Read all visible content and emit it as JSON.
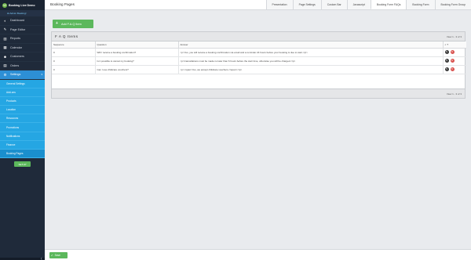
{
  "app": {
    "brand_name": "Booking Live Demo",
    "brand_logo": "W",
    "user_label": "Hi Admin Booking!"
  },
  "sidebar": {
    "items": [
      {
        "label": "Dashboard",
        "icon": "gauge-icon",
        "glyph": "◐"
      },
      {
        "label": "Page Editor",
        "icon": "pencil-icon",
        "glyph": "✎"
      },
      {
        "label": "Reports",
        "icon": "chart-icon",
        "glyph": "▥"
      },
      {
        "label": "Calendar",
        "icon": "calendar-icon",
        "glyph": "▦"
      },
      {
        "label": "Customers",
        "icon": "users-icon",
        "glyph": "☻"
      },
      {
        "label": "Orders",
        "icon": "cart-icon",
        "glyph": "▤"
      },
      {
        "label": "Settings",
        "icon": "gear-icon",
        "glyph": "⚙"
      }
    ],
    "settings_chevron": "▾",
    "submenu": [
      "General Settings",
      "Add-ons",
      "Products",
      "Location",
      "Resources",
      "Promotions",
      "Notifications",
      "Finance",
      "Booking Pages"
    ],
    "setup_button": "SETUP"
  },
  "header": {
    "title": "Booking Pages",
    "tabs": [
      "Presentation",
      "Page Settings",
      "Custom Bar",
      "Javascript",
      "Booking Form FAQs",
      "Booking Form",
      "Booking Form Group"
    ],
    "active_tab": "Booking Form FAQs"
  },
  "main": {
    "add_button": "Add F.A.Q Item",
    "grid": {
      "caption": "F A Q Items",
      "view_info": "View 1 - 3 of 3",
      "columns": [
        "Sequence",
        "Question",
        "Answer",
        ""
      ],
      "filter_glyph": "⌕ ▾",
      "rows": [
        {
          "sequence": "0",
          "question": "Will I receive a booking confirmation?",
          "answer": "<p>Yes, you will receive a booking confirmation via email and a reminder 24 hours before your booking is due to start.</p>"
        },
        {
          "sequence": "0",
          "question": "Is it possible to cancel my booking?",
          "answer": "<p>Cancellations must be made no later than 6 hours before the start time, otherwise you will be charged.</p>"
        },
        {
          "sequence": "0",
          "question": "Can I use childcare vouchers?",
          "answer": "<p><span>Yes, we accept childcare vouchers.</span></p>"
        }
      ],
      "footer_view_info": "View 1 - 3 of 3"
    }
  },
  "footer": {
    "save_label": "Save"
  },
  "colors": {
    "sidebar_bg": "#1f2a3a",
    "submenu_bg": "#25a6e3",
    "accent_green": "#5cb85c",
    "delete_red": "#d9534f"
  }
}
